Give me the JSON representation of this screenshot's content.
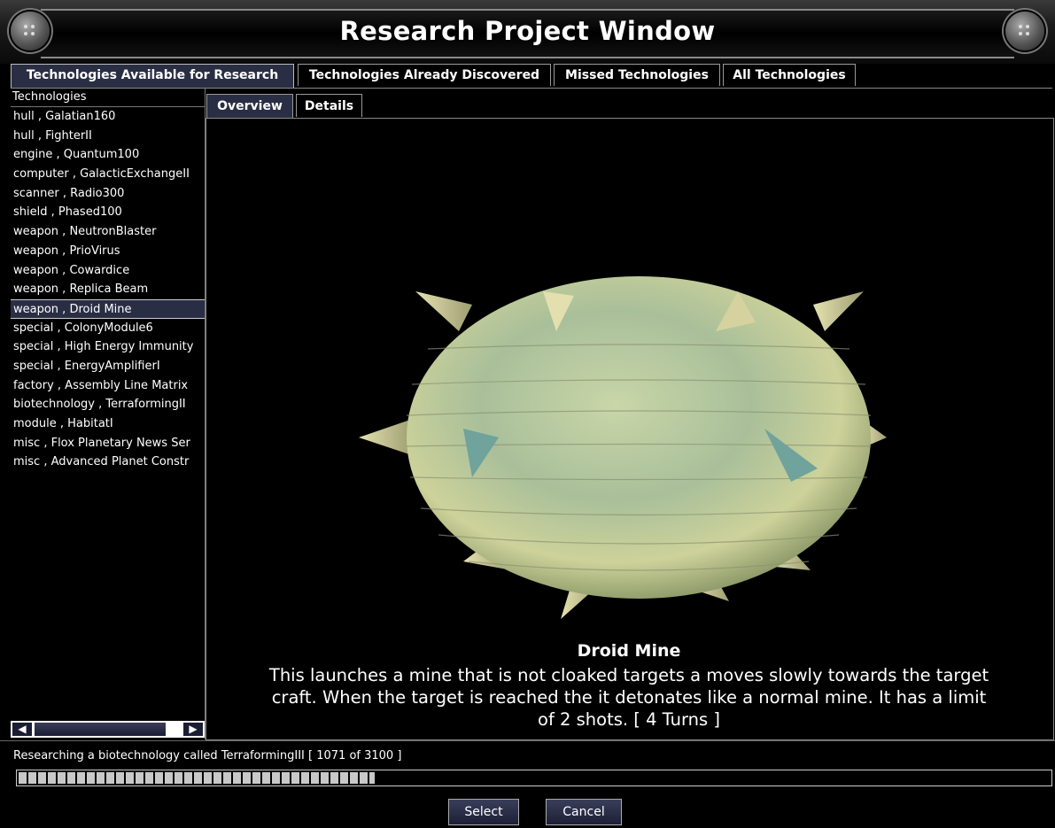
{
  "window": {
    "title": "Research Project Window"
  },
  "tabs": [
    {
      "label": "Technologies Available for Research",
      "active": true
    },
    {
      "label": "Technologies Already Discovered",
      "active": false
    },
    {
      "label": "Missed Technologies",
      "active": false
    },
    {
      "label": "All Technologies",
      "active": false
    }
  ],
  "list": {
    "header": "Technologies",
    "items": [
      "hull , Galatian160",
      "hull , FighterII",
      "engine , Quantum100",
      "computer , GalacticExchangeII",
      "scanner , Radio300",
      "shield , Phased100",
      "weapon , NeutronBlaster",
      "weapon , PrioVirus",
      "weapon , Cowardice",
      "weapon , Replica Beam",
      "weapon , Droid Mine",
      "special , ColonyModule6",
      "special , High Energy Immunity",
      "special , EnergyAmplifierI",
      "factory , Assembly Line Matrix",
      "biotechnology , TerraformingII",
      "module , HabitatI",
      "misc , Flox Planetary News Ser",
      "misc , Advanced Planet Constr"
    ],
    "selected_index": 10
  },
  "subtabs": [
    {
      "label": "Overview",
      "active": true
    },
    {
      "label": "Details",
      "active": false
    }
  ],
  "detail": {
    "name": "Droid Mine",
    "description": "This launches a mine that is not cloaked targets a moves slowly towards the target craft. When the target is reached the it detonates like a normal mine. It has a limit of 2 shots. [ 4 Turns ]"
  },
  "status": {
    "text": "Researching a biotechnology called TerraformingIII [ 1071 of 3100 ]",
    "progress": 0.345
  },
  "buttons": {
    "select": "Select",
    "cancel": "Cancel"
  },
  "colors": {
    "accent": "#2a2e44",
    "background": "#000000"
  }
}
